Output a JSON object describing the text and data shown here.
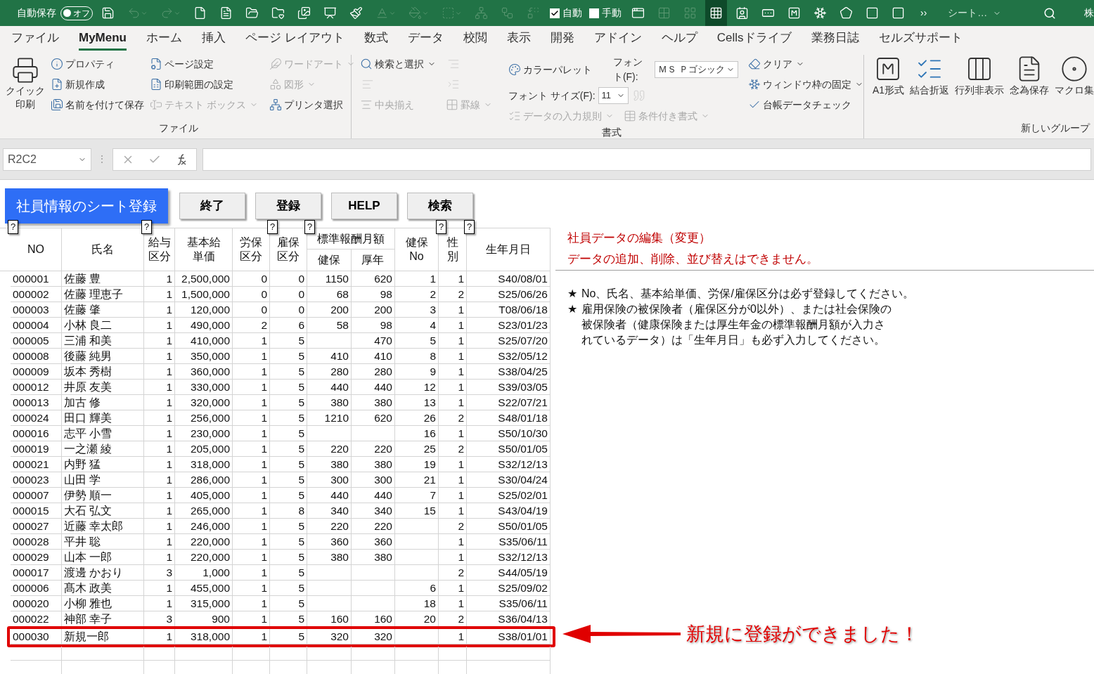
{
  "toolbar": {
    "autosave_label": "自動保存",
    "autosave_toggle": {
      "label": "オフ",
      "on": false
    },
    "items": [
      {
        "kind": "icon",
        "disabled": false,
        "selected": false
      },
      {
        "kind": "icon",
        "disabled": true,
        "selected": false
      },
      {
        "kind": "icon",
        "disabled": true,
        "selected": false
      },
      {
        "kind": "icon",
        "disabled": false,
        "selected": false
      },
      {
        "kind": "icon",
        "disabled": false,
        "selected": false
      },
      {
        "kind": "icon",
        "disabled": false,
        "selected": false
      },
      {
        "kind": "icon",
        "disabled": false,
        "selected": false
      },
      {
        "kind": "icon",
        "disabled": false,
        "selected": false
      },
      {
        "kind": "icon",
        "disabled": false,
        "selected": false
      },
      {
        "kind": "icon",
        "disabled": false,
        "selected": false
      },
      {
        "kind": "icon",
        "disabled": true,
        "selected": false
      },
      {
        "kind": "icon",
        "disabled": true,
        "selected": false
      },
      {
        "kind": "icon",
        "disabled": true,
        "selected": false
      },
      {
        "kind": "icon",
        "disabled": true,
        "selected": false
      },
      {
        "kind": "icon",
        "disabled": true,
        "selected": false
      },
      {
        "kind": "icon",
        "disabled": true,
        "selected": false
      },
      {
        "kind": "check",
        "label": "自動",
        "checked": true
      },
      {
        "kind": "check",
        "label": "手動",
        "checked": false
      },
      {
        "kind": "icon",
        "disabled": false,
        "selected": false
      },
      {
        "kind": "icon",
        "disabled": true,
        "selected": false
      },
      {
        "kind": "icon",
        "disabled": true,
        "selected": false
      },
      {
        "kind": "icon",
        "disabled": false,
        "selected": true
      },
      {
        "kind": "icon",
        "disabled": false,
        "selected": false
      },
      {
        "kind": "icon",
        "disabled": false,
        "selected": false
      },
      {
        "kind": "icon",
        "disabled": false,
        "selected": false
      },
      {
        "kind": "icon",
        "disabled": false,
        "selected": false
      },
      {
        "kind": "icon",
        "disabled": false,
        "selected": false
      },
      {
        "kind": "icon",
        "disabled": false,
        "selected": false
      },
      {
        "kind": "icon",
        "disabled": false,
        "selected": false
      }
    ],
    "more": "››",
    "sheet_menu": "シート…",
    "cut_text": "株"
  },
  "tabs": [
    {
      "label": "ファイル",
      "selected": false
    },
    {
      "label": "MyMenu",
      "selected": true
    },
    {
      "label": "ホーム",
      "selected": false
    },
    {
      "label": "挿入",
      "selected": false
    },
    {
      "label": "ページ レイアウト",
      "selected": false
    },
    {
      "label": "数式",
      "selected": false
    },
    {
      "label": "データ",
      "selected": false
    },
    {
      "label": "校閲",
      "selected": false
    },
    {
      "label": "表示",
      "selected": false
    },
    {
      "label": "開発",
      "selected": false
    },
    {
      "label": "アドイン",
      "selected": false
    },
    {
      "label": "ヘルプ",
      "selected": false
    },
    {
      "label": "Cellsドライブ",
      "selected": false
    },
    {
      "label": "業務日誌",
      "selected": false
    },
    {
      "label": "セルズサポート",
      "selected": false
    }
  ],
  "ribbon": {
    "file_group": {
      "label": "ファイル",
      "big_button": {
        "lines": [
          "クイック",
          "印刷"
        ]
      },
      "columns": [
        [
          {
            "label": "プロパティ",
            "disabled": false,
            "dropdown": false
          },
          {
            "label": "新規作成",
            "disabled": false,
            "dropdown": false
          },
          {
            "label": "名前を付けて保存",
            "disabled": false,
            "dropdown": false
          }
        ],
        [
          {
            "label": "ページ設定",
            "disabled": false,
            "dropdown": false
          },
          {
            "label": "印刷範囲の設定",
            "disabled": false,
            "dropdown": false
          },
          {
            "label": "テキスト ボックス",
            "disabled": true,
            "dropdown": true
          }
        ],
        [
          {
            "label": "ワードアート",
            "disabled": true,
            "dropdown": true
          },
          {
            "label": "図形",
            "disabled": true,
            "dropdown": true
          },
          {
            "label": "プリンタ選択",
            "disabled": false,
            "dropdown": false
          }
        ]
      ]
    },
    "format_group": {
      "label": "書式",
      "find": {
        "label": "検索と選択",
        "disabled": false,
        "dropdown": true
      },
      "align_left": {
        "disabled": true
      },
      "center": {
        "label": "中央揃え",
        "disabled": true
      },
      "align_right": {
        "disabled": true
      },
      "indent": {
        "disabled": true
      },
      "borders": {
        "label": "罫線",
        "disabled": true,
        "dropdown": true
      },
      "palette": {
        "label": "カラーパレット",
        "disabled": false
      },
      "font_size": {
        "label": "フォント サイズ(F):",
        "value": "11"
      },
      "validation": {
        "label": "データの入力規則",
        "disabled": true,
        "dropdown": true
      },
      "font": {
        "label": "フォント(F):",
        "value": "ＭＳ Ｐゴシック"
      },
      "comma": {
        "disabled": true
      },
      "conditional": {
        "label": "条件付き書式",
        "disabled": true,
        "dropdown": true
      },
      "clear": {
        "label": "クリア",
        "disabled": false,
        "dropdown": true
      },
      "freeze": {
        "label": "ウィンドウ枠の固定",
        "disabled": false,
        "dropdown": true
      },
      "check": {
        "label": "台帳データチェック",
        "disabled": false
      }
    },
    "new_group": {
      "label": "新しいグループ",
      "buttons": [
        "A1形式",
        "結合折返",
        "行列非表示",
        "念為保存",
        "マクロ集"
      ]
    }
  },
  "formula_bar": {
    "name_box": "R2C2",
    "grip": "⋮"
  },
  "sheet_buttons": [
    {
      "label": "社員情報のシート登録",
      "kind": "title"
    },
    {
      "label": "終了",
      "kind": "button"
    },
    {
      "label": "登録",
      "kind": "button"
    },
    {
      "label": "HELP",
      "kind": "button"
    },
    {
      "label": "検索",
      "kind": "button"
    }
  ],
  "table": {
    "columns": [
      {
        "lines": [
          "NO"
        ],
        "help": "?"
      },
      {
        "lines": [
          "氏名"
        ]
      },
      {
        "lines": [
          "給与",
          "区分"
        ],
        "help": "?"
      },
      {
        "lines": [
          "基本給",
          "単価"
        ]
      },
      {
        "lines": [
          "労保",
          "区分"
        ]
      },
      {
        "lines": [
          "雇保",
          "区分"
        ],
        "help": "?"
      },
      {
        "lines": [
          "健保"
        ],
        "group": "標準報酬月額",
        "help": "?"
      },
      {
        "lines": [
          "厚年"
        ],
        "group_continues": true
      },
      {
        "lines": [
          "健保",
          "No"
        ]
      },
      {
        "lines": [
          "性",
          "別"
        ],
        "help": "?"
      },
      {
        "lines": [
          "生年月日"
        ],
        "help": "?"
      }
    ],
    "rows": [
      {
        "highlighted": false,
        "cells": [
          "000001",
          "佐藤 豊",
          "1",
          "2,500,000",
          "0",
          "0",
          "1150",
          "620",
          "1",
          "1",
          "S40/08/01"
        ]
      },
      {
        "highlighted": false,
        "cells": [
          "000002",
          "佐藤 理恵子",
          "1",
          "1,500,000",
          "0",
          "0",
          "68",
          "98",
          "2",
          "2",
          "S25/06/26"
        ]
      },
      {
        "highlighted": false,
        "cells": [
          "000003",
          "佐藤 肇",
          "1",
          "120,000",
          "0",
          "0",
          "200",
          "200",
          "3",
          "1",
          "T08/06/18"
        ]
      },
      {
        "highlighted": false,
        "cells": [
          "000004",
          "小林 良二",
          "1",
          "490,000",
          "2",
          "6",
          "58",
          "98",
          "4",
          "1",
          "S23/01/23"
        ]
      },
      {
        "highlighted": false,
        "cells": [
          "000005",
          "三浦 和美",
          "1",
          "410,000",
          "1",
          "5",
          null,
          "470",
          "5",
          "1",
          "S25/07/20"
        ]
      },
      {
        "highlighted": false,
        "cells": [
          "000008",
          "後藤 純男",
          "1",
          "350,000",
          "1",
          "5",
          "410",
          "410",
          "8",
          "1",
          "S32/05/12"
        ]
      },
      {
        "highlighted": false,
        "cells": [
          "000009",
          "坂本 秀樹",
          "1",
          "360,000",
          "1",
          "5",
          "280",
          "280",
          "9",
          "1",
          "S38/04/25"
        ]
      },
      {
        "highlighted": false,
        "cells": [
          "000012",
          "井原 友美",
          "1",
          "330,000",
          "1",
          "5",
          "440",
          "440",
          "12",
          "1",
          "S39/03/05"
        ]
      },
      {
        "highlighted": false,
        "cells": [
          "000013",
          "加古 修",
          "1",
          "320,000",
          "1",
          "5",
          "380",
          "380",
          "13",
          "1",
          "S22/07/21"
        ]
      },
      {
        "highlighted": false,
        "cells": [
          "000024",
          "田口 輝美",
          "1",
          "256,000",
          "1",
          "5",
          "1210",
          "620",
          "26",
          "2",
          "S48/01/18"
        ]
      },
      {
        "highlighted": false,
        "cells": [
          "000016",
          "志平 小雪",
          "1",
          "230,000",
          "1",
          "5",
          null,
          null,
          "16",
          "1",
          "S50/10/30"
        ]
      },
      {
        "highlighted": false,
        "cells": [
          "000019",
          "一之瀬 綾",
          "1",
          "205,000",
          "1",
          "5",
          "220",
          "220",
          "25",
          "2",
          "S50/01/05"
        ]
      },
      {
        "highlighted": false,
        "cells": [
          "000021",
          "内野 猛",
          "1",
          "318,000",
          "1",
          "5",
          "380",
          "380",
          "19",
          "1",
          "S32/12/13"
        ]
      },
      {
        "highlighted": false,
        "cells": [
          "000023",
          "山田 学",
          "1",
          "286,000",
          "1",
          "5",
          "300",
          "300",
          "21",
          "1",
          "S30/04/24"
        ]
      },
      {
        "highlighted": false,
        "cells": [
          "000007",
          "伊勢 順一",
          "1",
          "405,000",
          "1",
          "5",
          "440",
          "440",
          "7",
          "1",
          "S25/02/01"
        ]
      },
      {
        "highlighted": false,
        "cells": [
          "000015",
          "大石 弘文",
          "1",
          "265,000",
          "1",
          "8",
          "340",
          "340",
          "15",
          "1",
          "S43/04/19"
        ]
      },
      {
        "highlighted": false,
        "cells": [
          "000027",
          "近藤 幸太郎",
          "1",
          "246,000",
          "1",
          "5",
          "220",
          "220",
          null,
          "2",
          "S50/01/05"
        ]
      },
      {
        "highlighted": false,
        "cells": [
          "000028",
          "平井 聡",
          "1",
          "220,000",
          "1",
          "5",
          "360",
          "360",
          null,
          "1",
          "S35/06/11"
        ]
      },
      {
        "highlighted": false,
        "cells": [
          "000029",
          "山本 一郎",
          "1",
          "220,000",
          "1",
          "5",
          "380",
          "380",
          null,
          "1",
          "S32/12/13"
        ]
      },
      {
        "highlighted": false,
        "cells": [
          "000017",
          "渡邊 かおり",
          "3",
          "1,000",
          "1",
          "5",
          null,
          null,
          null,
          "2",
          "S44/05/19"
        ]
      },
      {
        "highlighted": false,
        "cells": [
          "000006",
          "髙木 政美",
          "1",
          "455,000",
          "1",
          "5",
          null,
          null,
          "6",
          "1",
          "S25/09/02"
        ]
      },
      {
        "highlighted": false,
        "cells": [
          "000020",
          "小柳 雅也",
          "1",
          "315,000",
          "1",
          "5",
          null,
          null,
          "18",
          "1",
          "S35/06/11"
        ]
      },
      {
        "highlighted": false,
        "cells": [
          "000022",
          "神部 幸子",
          "3",
          "900",
          "1",
          "5",
          "160",
          "160",
          "20",
          "2",
          "S36/04/13"
        ]
      },
      {
        "highlighted": true,
        "cells": [
          "000030",
          "新規一郎",
          "1",
          "318,000",
          "1",
          "5",
          "320",
          "320",
          null,
          "1",
          "S38/01/01"
        ]
      }
    ]
  },
  "notes": {
    "red_lines": [
      "社員データの編集（変更）",
      "データの追加、削除、並び替えはできません。"
    ],
    "items": [
      {
        "mark": "★",
        "lines": [
          "No、氏名、基本給単価、労保/雇保区分は必ず登録してください。"
        ]
      },
      {
        "mark": "★",
        "lines": [
          "雇用保険の被保険者（雇保区分が0以外）、または社会保険の",
          "被保険者（健康保険または厚生年金の標準報酬月額が入力さ",
          "れているデータ）は「生年月日」も必ず入力してください。"
        ]
      }
    ]
  },
  "callout": "新規に登録ができました！"
}
